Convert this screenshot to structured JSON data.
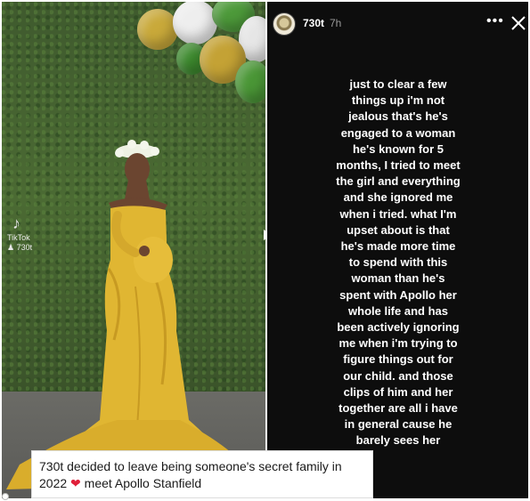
{
  "story": {
    "username": "730t",
    "time_ago": "7h",
    "more_icon": "more-horizontal-icon",
    "close_icon": "close-icon",
    "text": "just to clear a few\nthings up i'm not\njealous that's he's\nengaged to a woman\nhe's known for 5\nmonths, I tried to meet\nthe girl and everything\nand she ignored me\nwhen i tried. what I'm\nupset about is that\nhe's made more time\nto spend with this\nwoman than he's\nspent with Apollo her\nwhole life and has\nbeen actively ignoring\nme when i'm trying to\nfigure things out for\nour child. and those\nclips of him and her\ntogether are all i have\nin general cause he\nbarely sees her"
  },
  "photo": {
    "watermark_brand": "TikTok",
    "watermark_handle": "730t",
    "dress_color": "#e0b632",
    "balloon_colors": [
      "#c9a93a",
      "#4d9a3a",
      "#eeeeee",
      "#3d8a2e"
    ]
  },
  "caption": {
    "line1": "730t decided to leave being someone's secret family in",
    "line2_prefix": "2022",
    "line2_suffix": "meet Apollo Stanfield"
  }
}
